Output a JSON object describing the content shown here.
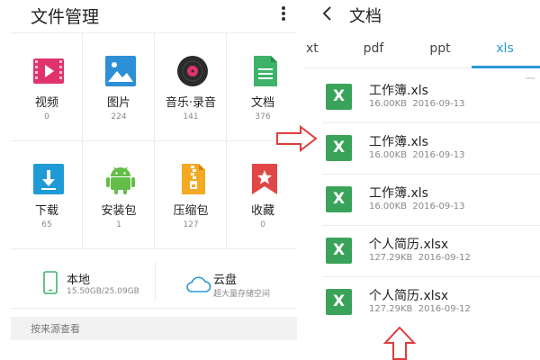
{
  "left": {
    "title": "文件管理",
    "categories": [
      {
        "label": "视频",
        "count": "0",
        "icon": "video-icon",
        "color": "#e0336b"
      },
      {
        "label": "图片",
        "count": "224",
        "icon": "image-icon",
        "color": "#2d8fd6"
      },
      {
        "label": "音乐·录音",
        "count": "141",
        "icon": "music-icon",
        "color": "#2b2b2b"
      },
      {
        "label": "文档",
        "count": "376",
        "icon": "document-icon",
        "color": "#3db36a"
      },
      {
        "label": "下载",
        "count": "65",
        "icon": "download-icon",
        "color": "#1e9ad6"
      },
      {
        "label": "安装包",
        "count": "1",
        "icon": "android-icon",
        "color": "#64bd48"
      },
      {
        "label": "压缩包",
        "count": "127",
        "icon": "zip-icon",
        "color": "#f4a922"
      },
      {
        "label": "收藏",
        "count": "0",
        "icon": "bookmark-icon",
        "color": "#e14747"
      }
    ],
    "storage": {
      "local": {
        "title": "本地",
        "sub": "15.50GB/25.09GB"
      },
      "cloud": {
        "title": "云盘",
        "sub": "超大量存储空间"
      }
    },
    "source_label": "按来源查看"
  },
  "right": {
    "title": "文档",
    "tabs": [
      "xt",
      "pdf",
      "ppt",
      "xls"
    ],
    "active_tab": "xls",
    "files": [
      {
        "name": "工作簿.xls",
        "size": "16.00KB",
        "date": "2016-09-13"
      },
      {
        "name": "工作簿.xls",
        "size": "16.00KB",
        "date": "2016-09-13"
      },
      {
        "name": "工作簿.xls",
        "size": "16.00KB",
        "date": "2016-09-13"
      },
      {
        "name": "个人简历.xlsx",
        "size": "127.29KB",
        "date": "2016-09-12"
      },
      {
        "name": "个人简历.xlsx",
        "size": "127.29KB",
        "date": "2016-09-12"
      }
    ],
    "file_icon_letter": "X"
  },
  "colors": {
    "accent": "#2a9ad6",
    "xls_green": "#3aa35a",
    "arrow_red": "#e03c3c"
  }
}
